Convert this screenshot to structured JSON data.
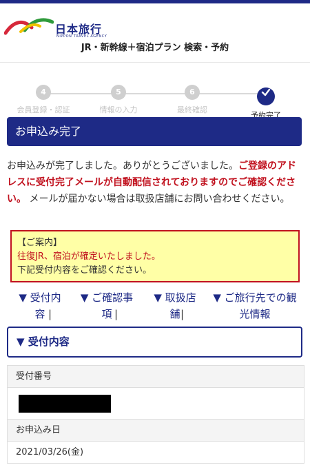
{
  "header": {
    "logo_name": "日本旅行",
    "logo_sub": "NIPPON TRAVEL AGENCY",
    "page_title": "JR・新幹線＋宿泊プラン 検索・予約"
  },
  "steps": [
    {
      "num": "4",
      "label": "会員登録・認証"
    },
    {
      "num": "5",
      "label": "情報の入力"
    },
    {
      "num": "6",
      "label": "最終確認"
    },
    {
      "num": "",
      "label": "予約完了"
    }
  ],
  "complete_title": "お申込み完了",
  "message": {
    "line1": "お申込みが完了しました。ありがとうございました。",
    "red": "ご登録のアドレスに受付完了メールが自動配信されておりますのでご確認ください。",
    "rest": "メールが届かない場合は取扱店舗にお問い合わせください。"
  },
  "notice": {
    "title": "【ご案内】",
    "red_line": "往復JR、宿泊が確定いたしました。",
    "plain_line": "下記受付内容をご確認ください。"
  },
  "links": [
    {
      "line1": "▼ 受付内",
      "line2": "容"
    },
    {
      "line1": "▼ ご確認事",
      "line2": "項"
    },
    {
      "line1": "▼ 取扱店",
      "line2": "舗"
    },
    {
      "line1": "▼ ご旅行先での観",
      "line2": "光情報"
    }
  ],
  "separator": "|",
  "section": {
    "title": "▼ 受付内容"
  },
  "details": {
    "receipt_label": "受付番号",
    "date_label": "お申込み日",
    "date_value": "2021/03/26(金)"
  },
  "colors": {
    "brand": "#1e2a86",
    "alert": "#c1121f",
    "notice_bg": "#ffffa6"
  }
}
